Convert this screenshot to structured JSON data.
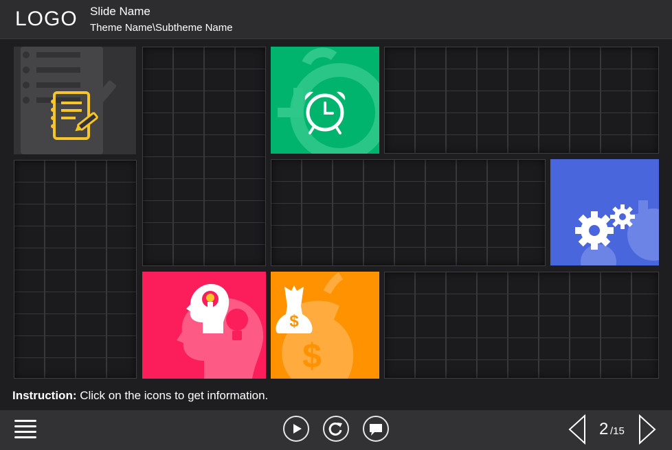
{
  "header": {
    "logo": "LOGO",
    "slide_name": "Slide Name",
    "theme_name": "Theme Name\\Subtheme Name"
  },
  "tiles": [
    {
      "name": "notes",
      "icon": "notepad-pencil-icon",
      "color": "#333335"
    },
    {
      "name": "clock",
      "icon": "alarm-clock-icon",
      "color": "#00b46e"
    },
    {
      "name": "gears",
      "icon": "gears-icon",
      "color": "#4a66dc"
    },
    {
      "name": "idea",
      "icon": "head-lightbulb-icon",
      "color": "#fb1e5a"
    },
    {
      "name": "money",
      "icon": "money-bag-icon",
      "color": "#ff9200"
    }
  ],
  "instruction": {
    "label": "Instruction:",
    "text": " Click on the icons to get information."
  },
  "footer": {
    "menu_icon": "hamburger-menu-icon",
    "play_icon": "play-icon",
    "replay_icon": "replay-icon",
    "comment_icon": "comment-icon",
    "prev_icon": "prev-arrow-icon",
    "next_icon": "next-arrow-icon",
    "page_current": "2",
    "page_total": "/15"
  }
}
